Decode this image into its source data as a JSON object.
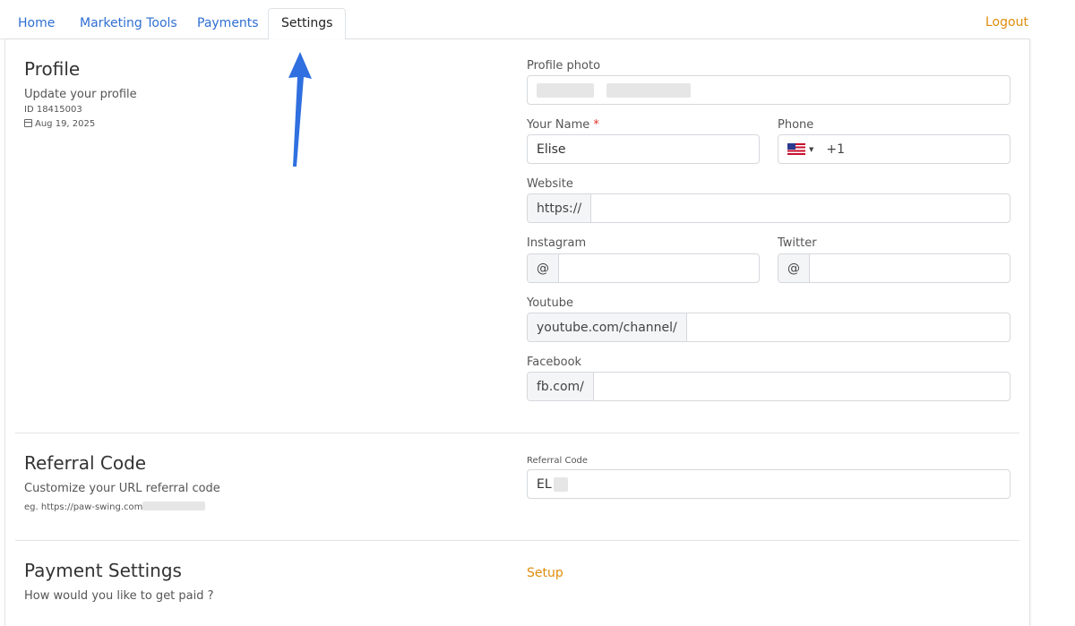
{
  "tabs": [
    {
      "label": "Home"
    },
    {
      "label": "Marketing Tools"
    },
    {
      "label": "Payments"
    },
    {
      "label": "Settings"
    }
  ],
  "logout": "Logout",
  "profile": {
    "title": "Profile",
    "subtitle": "Update your profile",
    "id_text": "ID 18415003",
    "date": "Aug 19, 2025",
    "photo_label": "Profile photo",
    "name_label": "Your Name",
    "name_required": "*",
    "name_value": "Elise",
    "phone_label": "Phone",
    "phone_code": "+1",
    "website_label": "Website",
    "website_prefix": "https://",
    "instagram_label": "Instagram",
    "instagram_prefix": "@",
    "twitter_label": "Twitter",
    "twitter_prefix": "@",
    "youtube_label": "Youtube",
    "youtube_prefix": "youtube.com/channel/",
    "facebook_label": "Facebook",
    "facebook_prefix": "fb.com/"
  },
  "referral": {
    "title": "Referral Code",
    "subtitle": "Customize your URL referral code",
    "example": "eg. https://paw-swing.com",
    "field_label": "Referral Code",
    "field_value": "EL"
  },
  "payment": {
    "title": "Payment Settings",
    "subtitle": "How would you like to get paid ?",
    "setup_label": "Setup"
  },
  "colors": {
    "link_blue": "#2f6fd2",
    "accent_orange": "#e08d0b",
    "arrow_blue": "#2f6fe0",
    "required_red": "#e0322b"
  }
}
